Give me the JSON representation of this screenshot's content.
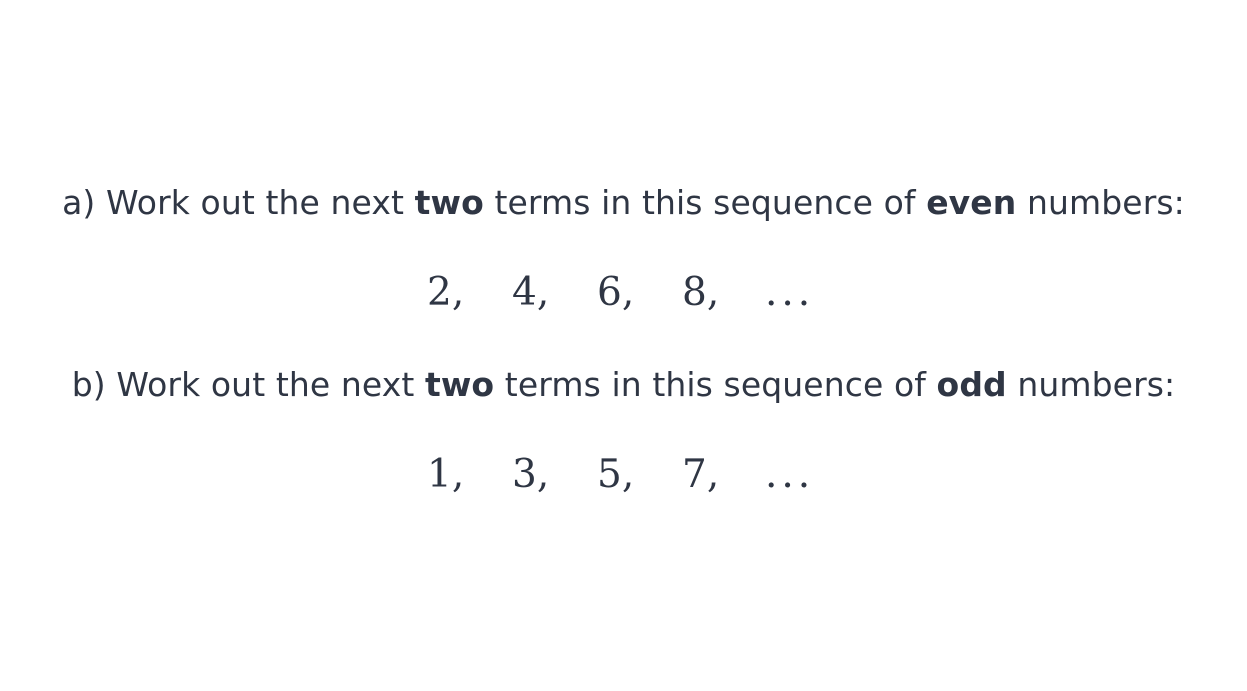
{
  "part_a": {
    "prefix": "a) Work out the next ",
    "bold_1": "two",
    "middle": " terms in this sequence of ",
    "bold_2": "even",
    "suffix": " numbers:",
    "terms": [
      "2,",
      "4,",
      "6,",
      "8,",
      "..."
    ]
  },
  "part_b": {
    "prefix": "b) Work out the next ",
    "bold_1": "two",
    "middle": " terms in this sequence of ",
    "bold_2": "odd",
    "suffix": " numbers:",
    "terms": [
      "1,",
      "3,",
      "5,",
      "7,",
      "..."
    ]
  },
  "colors": {
    "text": "#2f3644",
    "background": "#ffffff"
  }
}
